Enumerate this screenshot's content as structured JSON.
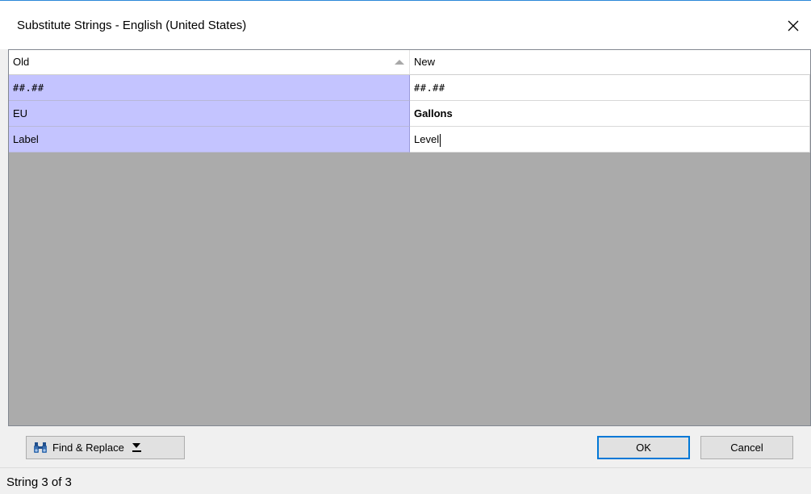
{
  "window": {
    "title": "Substitute Strings - English (United States)"
  },
  "grid": {
    "columns": [
      {
        "label": "Old",
        "sorted": "ascending"
      },
      {
        "label": "New"
      }
    ],
    "rows": [
      {
        "old": "##.##",
        "new": "##.##",
        "new_bold": false
      },
      {
        "old": "EU",
        "new": "Gallons",
        "new_bold": true
      },
      {
        "old": "Label",
        "new": "Level",
        "new_bold": false,
        "editing": true
      }
    ]
  },
  "footer": {
    "find_replace_label": "Find & Replace",
    "ok_label": "OK",
    "cancel_label": "Cancel"
  },
  "status": {
    "text": "String 3 of 3"
  },
  "colors": {
    "old_cell_bg": "#c4c4ff",
    "empty_area_bg": "#ababab",
    "ok_border": "#0078d7"
  }
}
